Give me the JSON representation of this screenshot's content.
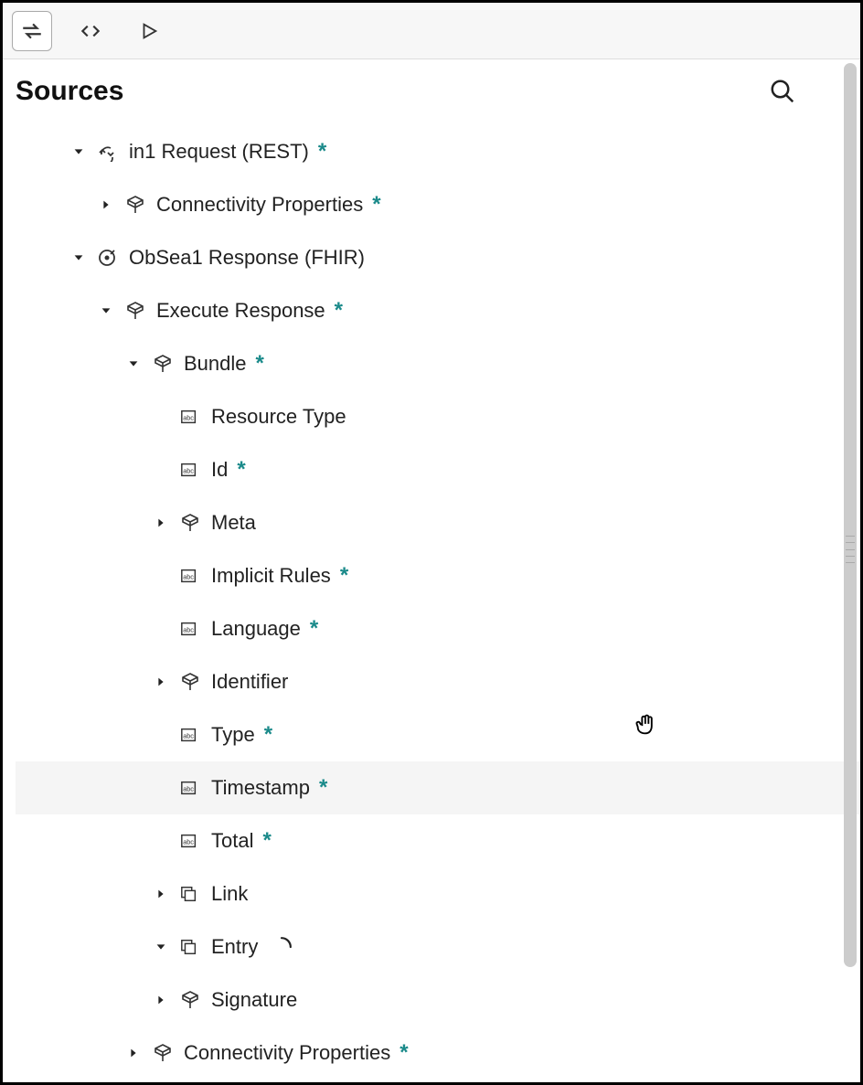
{
  "header": {
    "title": "Sources"
  },
  "tree": {
    "items": [
      {
        "depth": 0,
        "toggle": "down",
        "icon": "rest",
        "label": "in1 Request (REST)",
        "asterisk": true
      },
      {
        "depth": 1,
        "toggle": "right",
        "icon": "object",
        "label": "Connectivity Properties",
        "asterisk": true
      },
      {
        "depth": 0,
        "toggle": "down",
        "icon": "fhir",
        "label": "ObSea1 Response (FHIR)",
        "asterisk": false
      },
      {
        "depth": 1,
        "toggle": "down",
        "icon": "object",
        "label": "Execute Response",
        "asterisk": true
      },
      {
        "depth": 2,
        "toggle": "down",
        "icon": "object",
        "label": "Bundle",
        "asterisk": true
      },
      {
        "depth": 3,
        "toggle": "none",
        "icon": "string",
        "label": "Resource Type",
        "asterisk": false
      },
      {
        "depth": 3,
        "toggle": "none",
        "icon": "string",
        "label": "Id",
        "asterisk": true
      },
      {
        "depth": 3,
        "toggle": "right",
        "icon": "object",
        "label": "Meta",
        "asterisk": false
      },
      {
        "depth": 3,
        "toggle": "none",
        "icon": "string",
        "label": "Implicit Rules",
        "asterisk": true
      },
      {
        "depth": 3,
        "toggle": "none",
        "icon": "string",
        "label": "Language",
        "asterisk": true
      },
      {
        "depth": 3,
        "toggle": "right",
        "icon": "object",
        "label": "Identifier",
        "asterisk": false
      },
      {
        "depth": 3,
        "toggle": "none",
        "icon": "string",
        "label": "Type",
        "asterisk": true
      },
      {
        "depth": 3,
        "toggle": "none",
        "icon": "string",
        "label": "Timestamp",
        "asterisk": true,
        "highlight": true
      },
      {
        "depth": 3,
        "toggle": "none",
        "icon": "string",
        "label": "Total",
        "asterisk": true
      },
      {
        "depth": 3,
        "toggle": "right",
        "icon": "array",
        "label": "Link",
        "asterisk": false
      },
      {
        "depth": 3,
        "toggle": "down",
        "icon": "array",
        "label": "Entry",
        "asterisk": false,
        "spinner": true
      },
      {
        "depth": 3,
        "toggle": "right",
        "icon": "object",
        "label": "Signature",
        "asterisk": false
      },
      {
        "depth": 2,
        "toggle": "right",
        "icon": "object",
        "label": "Connectivity Properties",
        "asterisk": true
      }
    ]
  },
  "indent": {
    "base": 58,
    "step": 30
  }
}
